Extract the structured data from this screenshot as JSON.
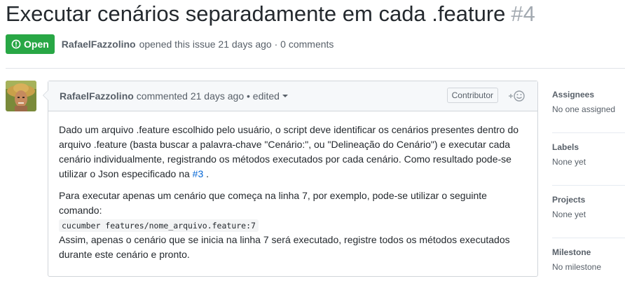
{
  "issue": {
    "title": "Executar cenários separadamente em cada .feature",
    "number": "#4",
    "state": "Open",
    "author": "RafaelFazzolino",
    "opened_text": "opened this issue 21 days ago · 0 comments"
  },
  "comment": {
    "author": "RafaelFazzolino",
    "meta": "commented 21 days ago • edited",
    "role": "Contributor",
    "p1_text": "Dado um arquivo .feature escolhido pelo usuário, o script deve identificar os cenários presentes dentro do arquivo .feature (basta buscar a palavra-chave \"Cenário:\", ou \"Delineação do Cenário\") e executar cada cenário individualmente, registrando os métodos executados por cada cenário. Como resultado pode-se utilizar o Json especificado na",
    "p1_link": "#3",
    "p1_end": ".",
    "p2_text": "Para executar apenas um cenário que começa na linha 7, por exemplo, pode-se utilizar o seguinte comando:",
    "code": "cucumber features/nome_arquivo.feature:7",
    "p2_tail": "Assim, apenas o cenário que se inicia na linha 7 será executado, registre todos os métodos executados durante este cenário e pronto."
  },
  "sidebar": {
    "assignees_label": "Assignees",
    "assignees_value": "No one assigned",
    "labels_label": "Labels",
    "labels_value": "None yet",
    "projects_label": "Projects",
    "projects_value": "None yet",
    "milestone_label": "Milestone",
    "milestone_value": "No milestone"
  },
  "colors": {
    "open_badge": "#28a745",
    "link": "#0366d6"
  }
}
